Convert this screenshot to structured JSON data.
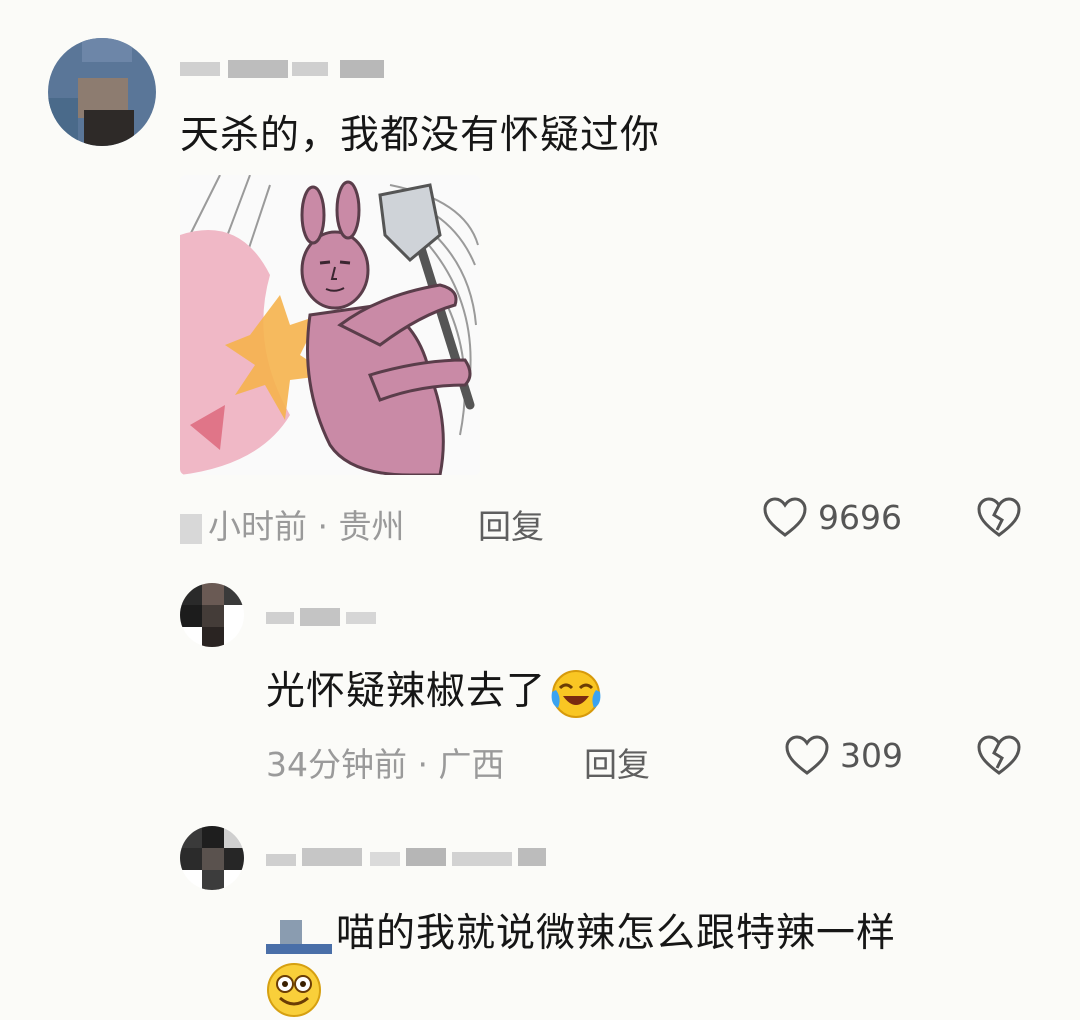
{
  "comments": [
    {
      "text": "天杀的，我都没有怀疑过你",
      "meta": "小时前 · 贵州",
      "reply_label": "回复",
      "likes": "9696"
    },
    {
      "text": "光怀疑辣椒去了",
      "meta": "34分钟前 · 广西",
      "reply_label": "回复",
      "likes": "309"
    },
    {
      "text": "喵的我就说微辣怎么跟特辣一样"
    }
  ],
  "icons": {
    "like": "heart-icon",
    "dislike": "broken-heart-icon",
    "emoji_laugh": "laughing-crying-emoji",
    "emoji_smile": "smiling-emoji",
    "sticker": "pink-rabbit-swinging-shovel-sticker"
  },
  "colors": {
    "text": "#161616",
    "meta": "#9a9a9a",
    "reply": "#5f5f5f",
    "background": "#fbfbf8",
    "rabbit": "#c98aa6"
  }
}
